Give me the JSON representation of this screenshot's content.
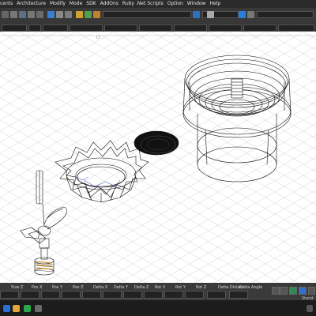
{
  "menu": [
    "cents",
    "Architecture",
    "Modify",
    "Mode",
    "SDK",
    "AddOns",
    "Ruby .Net Scripts",
    "Option",
    "Window",
    "Help"
  ],
  "status_labels": [
    "Size Z",
    "Pos X",
    "Pos Y",
    "Pos Z",
    "Delta X",
    "Delta Y",
    "Delta Z",
    "Rot X",
    "Rot Y",
    "Rot Z",
    "Delta Distanc",
    "Delta Angle"
  ],
  "status_right": "Stand",
  "colors": {
    "menubar": "#2b2b2b",
    "toolbar": "#383838",
    "grid": "#cfcfcf",
    "wire": "#111111"
  }
}
